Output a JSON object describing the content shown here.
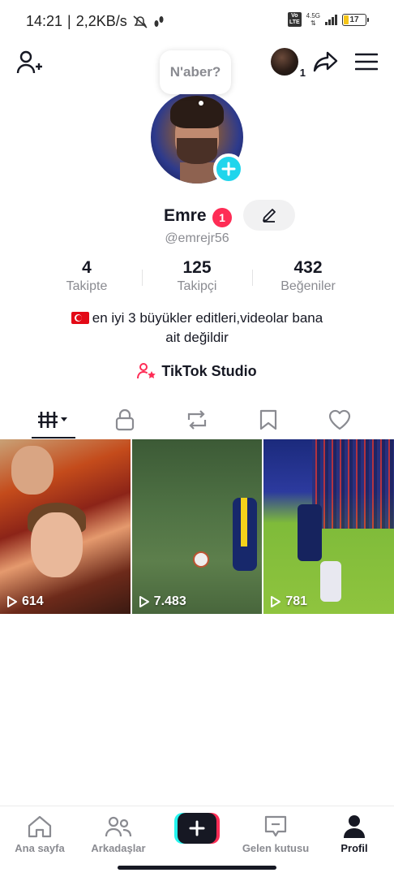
{
  "status_bar": {
    "time": "14:21",
    "net_speed": "2,2KB/s",
    "network_type": "4.5G",
    "battery": "17",
    "icons": [
      "mute-icon",
      "steps-icon",
      "volte-icon",
      "signal-icon",
      "battery-icon"
    ]
  },
  "top_bar": {
    "story_count": "1",
    "icons": [
      "add-friend-icon",
      "share-icon",
      "menu-icon"
    ]
  },
  "note_bubble": {
    "text": "N'aber?"
  },
  "profile": {
    "display_name": "Emre",
    "notification_count": "1",
    "username": "@emrejr56",
    "bio_line1": "en iyi 3 büyükler editleri,videolar bana",
    "bio_line2": "ait değildir",
    "studio_label": "TikTok Studio"
  },
  "stats": [
    {
      "value": "4",
      "label": "Takipte"
    },
    {
      "value": "125",
      "label": "Takipçi"
    },
    {
      "value": "432",
      "label": "Beğeniler"
    }
  ],
  "tabs": [
    {
      "icon": "videos-grid-icon",
      "active": true
    },
    {
      "icon": "lock-icon",
      "active": false
    },
    {
      "icon": "repost-icon",
      "active": false
    },
    {
      "icon": "bookmark-icon",
      "active": false
    },
    {
      "icon": "heart-icon",
      "active": false
    }
  ],
  "videos": [
    {
      "views": "614"
    },
    {
      "views": "7.483"
    },
    {
      "views": "781"
    }
  ],
  "bottom_nav": [
    {
      "label": "Ana sayfa",
      "icon": "home-icon"
    },
    {
      "label": "Arkadaşlar",
      "icon": "friends-icon"
    },
    {
      "label": "",
      "icon": "plus-icon"
    },
    {
      "label": "Gelen kutusu",
      "icon": "inbox-icon"
    },
    {
      "label": "Profil",
      "icon": "profile-icon",
      "active": true
    }
  ],
  "colors": {
    "accent_red": "#fe2c55",
    "accent_cyan": "#25f4ee",
    "text_primary": "#161823",
    "text_secondary": "#8a8b91"
  }
}
